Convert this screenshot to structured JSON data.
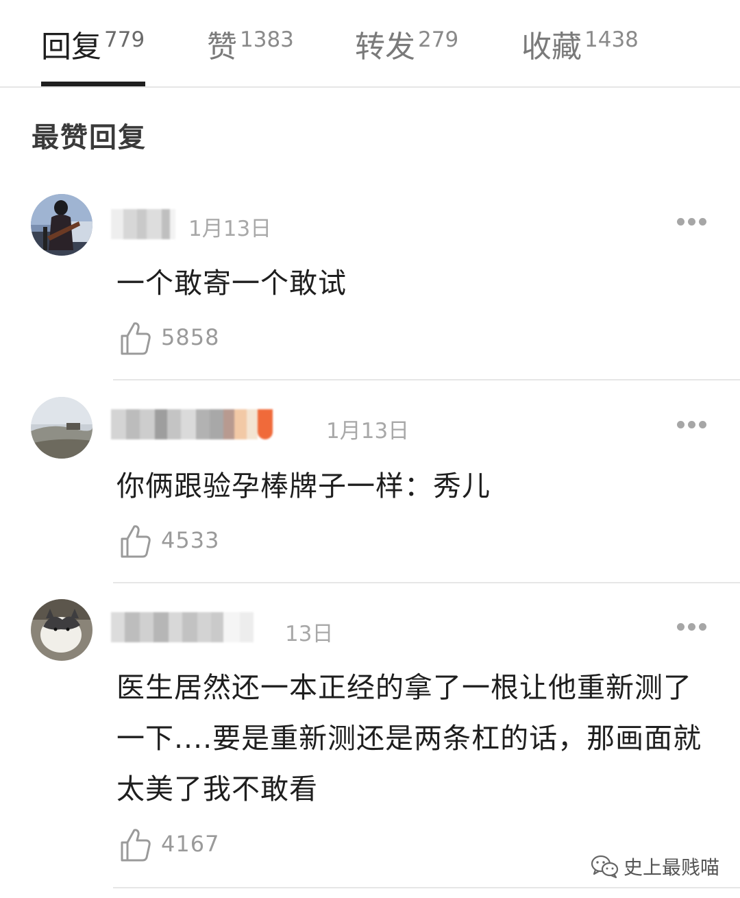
{
  "tabs": [
    {
      "label": "回复",
      "count": "779",
      "active": true
    },
    {
      "label": "赞",
      "count": "1383",
      "active": false
    },
    {
      "label": "转发",
      "count": "279",
      "active": false
    },
    {
      "label": "收藏",
      "count": "1438",
      "active": false
    }
  ],
  "section_title": "最赞回复",
  "comments": [
    {
      "date": "1月13日",
      "text": "一个敢寄一个敢试",
      "likes": "5858",
      "name_blurred": true
    },
    {
      "date": "1月13日",
      "text": "你俩跟验孕棒牌子一样：秀儿",
      "likes": "4533",
      "name_blurred": true
    },
    {
      "date": "13日",
      "text": "医生居然还一本正经的拿了一根让他重新测了一下....要是重新测还是两条杠的话，那画面就太美了我不敢看",
      "likes": "4167",
      "name_blurred": true
    }
  ],
  "watermark": {
    "text": "史上最贱喵",
    "icon": "wechat-icon"
  },
  "icons": {
    "more": "more-dots-icon",
    "like": "thumbs-up-icon"
  },
  "colors": {
    "text": "#1e1e1e",
    "muted": "#9a9a9a",
    "divider": "#e6e6e6",
    "tab_indicator": "#1f1f1f"
  }
}
